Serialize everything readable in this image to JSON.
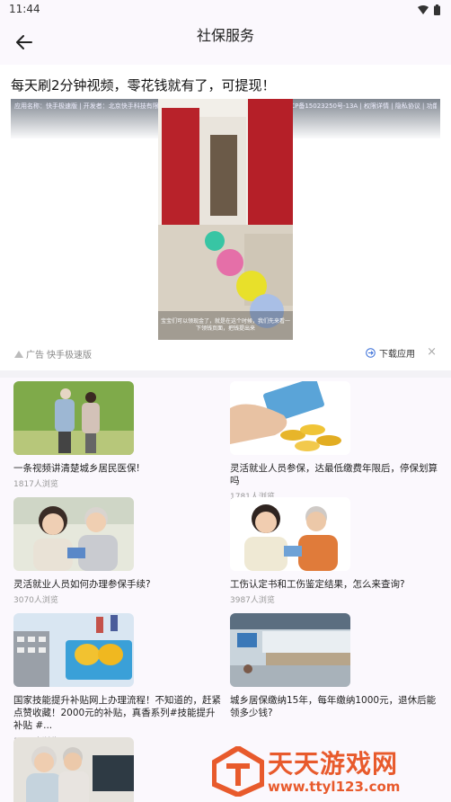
{
  "status_bar": {
    "time": "11:44"
  },
  "app_bar": {
    "title": "社保服务"
  },
  "ad": {
    "headline": "每天刷2分钟视频，零花钱就有了，可提现！",
    "meta_text": "应用名称：快手极速版 | 开发者：北京快手科技有限公司 | 应用版本：12.9.20.8877 | 备案号：京ICP备15023250号-13A | 权限详情 | 隐私协议 | 功能介绍",
    "video_caption": "宝宝们可以领现金了，就是在这个时候，我们先来看一下领钱页面，把钱提出来",
    "badge_label": "广告",
    "source": "快手极速版",
    "download_label": "下载应用",
    "close_label": "×"
  },
  "articles": [
    {
      "title": "一条视频讲清楚城乡居民医保!",
      "views": "1817人浏览"
    },
    {
      "title": "灵活就业人员参保，达最低缴费年限后，停保划算吗",
      "views": "1781人浏览"
    },
    {
      "title": "灵活就业人员如何办理参保手续?",
      "views": "3070人浏览"
    },
    {
      "title": "工伤认定书和工伤鉴定结果，怎么来查询?",
      "views": "3987人浏览"
    },
    {
      "title": "国家技能提升补贴网上办理流程！不知道的，赶紧点赞收藏！2000元的补贴，真香系列#技能提升补贴 #...",
      "views": "1855人浏览"
    },
    {
      "title": "城乡居保缴纳15年，每年缴纳1000元，退休后能领多少钱?",
      "views": ""
    }
  ],
  "watermark": {
    "title": "天天游戏网",
    "url": "www.ttyl123.com"
  },
  "colors": {
    "accent": "#e85a2c",
    "background": "#fbf8fd"
  }
}
